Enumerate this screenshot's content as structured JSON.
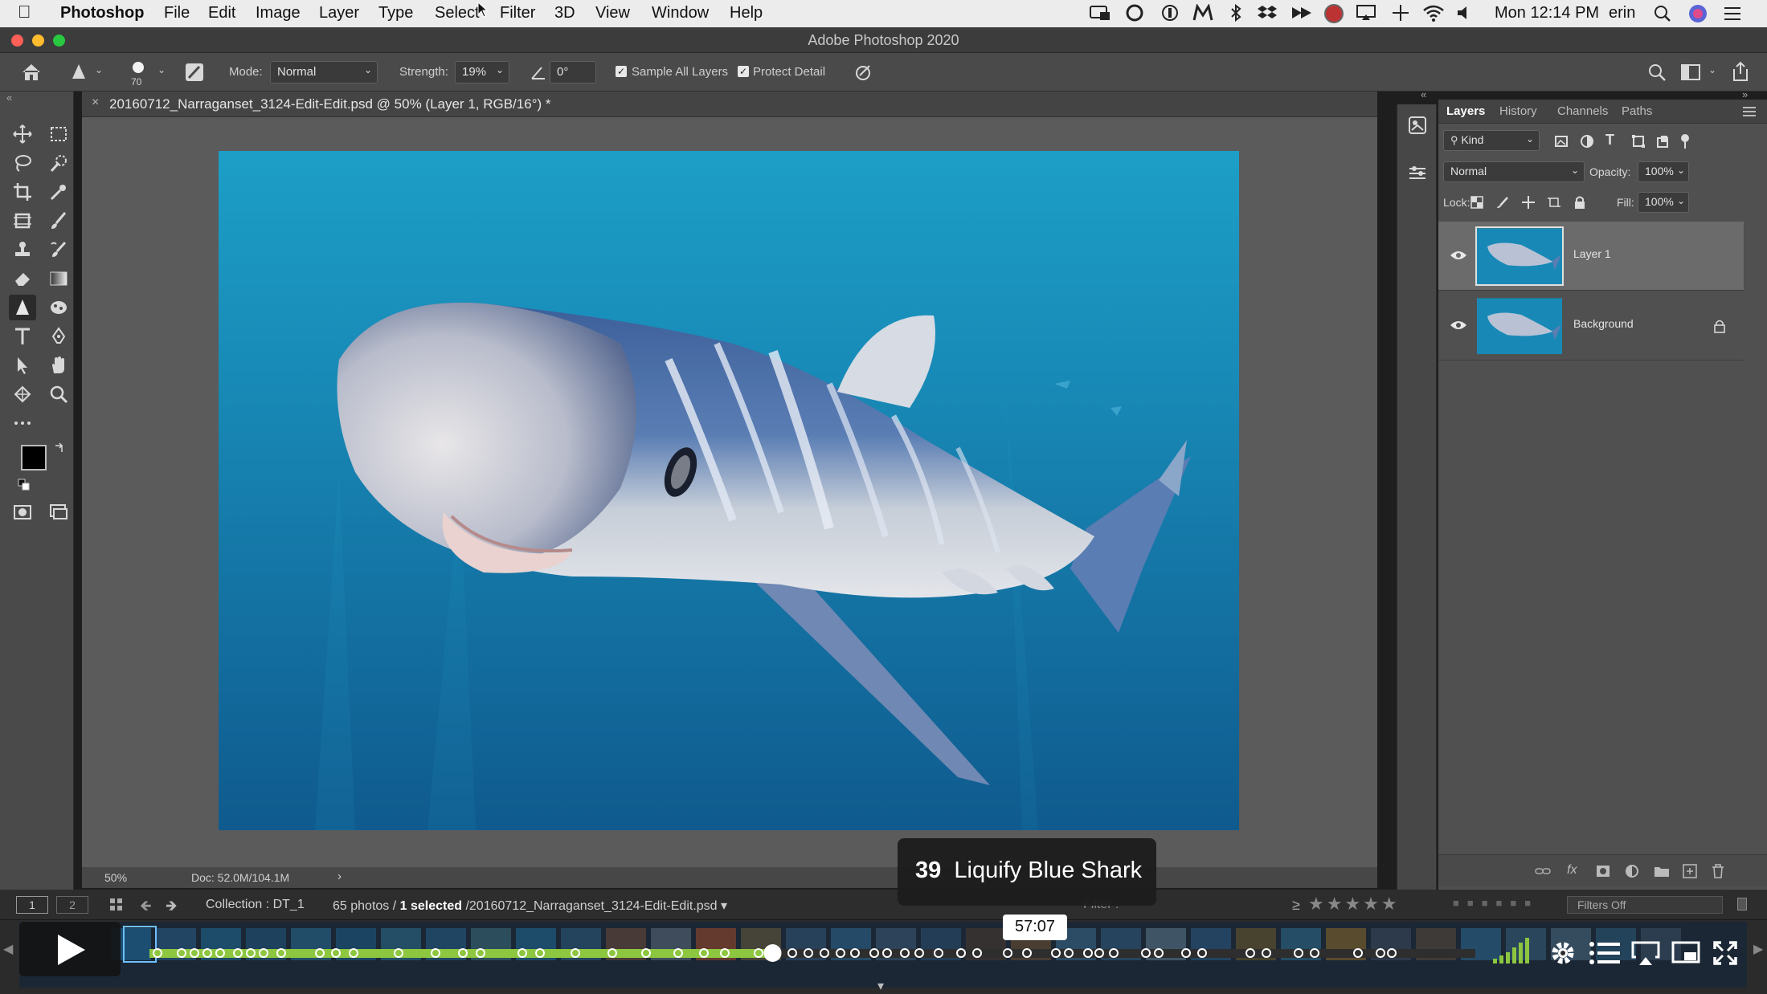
{
  "menubar": {
    "app": "Photoshop",
    "items": [
      "File",
      "Edit",
      "Image",
      "Layer",
      "Type",
      "Select",
      "Filter",
      "3D",
      "View",
      "Window",
      "Help"
    ],
    "clock": "Mon 12:14 PM",
    "user": "erin"
  },
  "window": {
    "title": "Adobe Photoshop 2020"
  },
  "options": {
    "brush_size": "70",
    "mode_label": "Mode:",
    "mode_value": "Normal",
    "strength_label": "Strength:",
    "strength_value": "19%",
    "angle_value": "0°",
    "sample_all_layers": "Sample All Layers",
    "protect_detail": "Protect Detail"
  },
  "document": {
    "tab_title": "20160712_Narraganset_3124-Edit-Edit.psd @ 50% (Layer 1, RGB/16°) *",
    "zoom": "50%",
    "doc_size": "Doc: 52.0M/104.1M"
  },
  "layers_panel": {
    "tabs": [
      "Layers",
      "History",
      "Channels",
      "Paths"
    ],
    "kind_label": "Kind",
    "blend_mode": "Normal",
    "opacity_label": "Opacity:",
    "opacity_value": "100%",
    "lock_label": "Lock:",
    "fill_label": "Fill:",
    "fill_value": "100%",
    "layers": [
      {
        "name": "Layer 1",
        "selected": true,
        "locked": false
      },
      {
        "name": "Background",
        "selected": false,
        "locked": true
      }
    ]
  },
  "filmstrip": {
    "page1": "1",
    "page2": "2",
    "collection": "Collection : DT_1",
    "count": "65 photos / ",
    "selected": "1 selected",
    "path": " /20160712_Narraganset_3124-Edit-Edit.psd",
    "filter_label": "Filter :",
    "rating_op": "≥",
    "filters_off": "Filters Off"
  },
  "video": {
    "chapter_number": "39",
    "chapter_title": "Liquify Blue Shark",
    "time": "57:07",
    "progress": 0.47,
    "accent_color": "#8dc63f"
  }
}
